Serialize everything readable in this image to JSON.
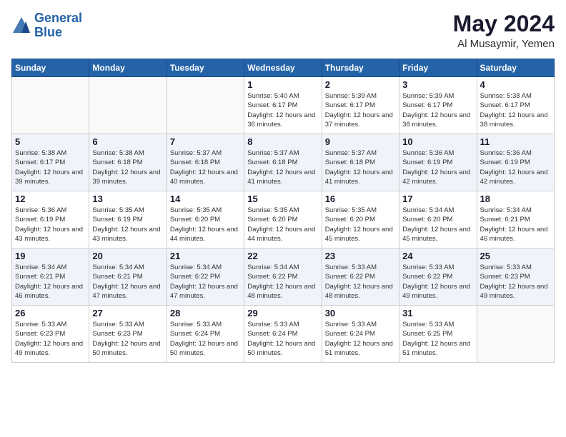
{
  "header": {
    "logo_line1": "General",
    "logo_line2": "Blue",
    "month_year": "May 2024",
    "location": "Al Musaymir, Yemen"
  },
  "weekdays": [
    "Sunday",
    "Monday",
    "Tuesday",
    "Wednesday",
    "Thursday",
    "Friday",
    "Saturday"
  ],
  "weeks": [
    [
      {
        "day": "",
        "sunrise": "",
        "sunset": "",
        "daylight": ""
      },
      {
        "day": "",
        "sunrise": "",
        "sunset": "",
        "daylight": ""
      },
      {
        "day": "",
        "sunrise": "",
        "sunset": "",
        "daylight": ""
      },
      {
        "day": "1",
        "sunrise": "Sunrise: 5:40 AM",
        "sunset": "Sunset: 6:17 PM",
        "daylight": "Daylight: 12 hours and 36 minutes."
      },
      {
        "day": "2",
        "sunrise": "Sunrise: 5:39 AM",
        "sunset": "Sunset: 6:17 PM",
        "daylight": "Daylight: 12 hours and 37 minutes."
      },
      {
        "day": "3",
        "sunrise": "Sunrise: 5:39 AM",
        "sunset": "Sunset: 6:17 PM",
        "daylight": "Daylight: 12 hours and 38 minutes."
      },
      {
        "day": "4",
        "sunrise": "Sunrise: 5:38 AM",
        "sunset": "Sunset: 6:17 PM",
        "daylight": "Daylight: 12 hours and 38 minutes."
      }
    ],
    [
      {
        "day": "5",
        "sunrise": "Sunrise: 5:38 AM",
        "sunset": "Sunset: 6:17 PM",
        "daylight": "Daylight: 12 hours and 39 minutes."
      },
      {
        "day": "6",
        "sunrise": "Sunrise: 5:38 AM",
        "sunset": "Sunset: 6:18 PM",
        "daylight": "Daylight: 12 hours and 39 minutes."
      },
      {
        "day": "7",
        "sunrise": "Sunrise: 5:37 AM",
        "sunset": "Sunset: 6:18 PM",
        "daylight": "Daylight: 12 hours and 40 minutes."
      },
      {
        "day": "8",
        "sunrise": "Sunrise: 5:37 AM",
        "sunset": "Sunset: 6:18 PM",
        "daylight": "Daylight: 12 hours and 41 minutes."
      },
      {
        "day": "9",
        "sunrise": "Sunrise: 5:37 AM",
        "sunset": "Sunset: 6:18 PM",
        "daylight": "Daylight: 12 hours and 41 minutes."
      },
      {
        "day": "10",
        "sunrise": "Sunrise: 5:36 AM",
        "sunset": "Sunset: 6:19 PM",
        "daylight": "Daylight: 12 hours and 42 minutes."
      },
      {
        "day": "11",
        "sunrise": "Sunrise: 5:36 AM",
        "sunset": "Sunset: 6:19 PM",
        "daylight": "Daylight: 12 hours and 42 minutes."
      }
    ],
    [
      {
        "day": "12",
        "sunrise": "Sunrise: 5:36 AM",
        "sunset": "Sunset: 6:19 PM",
        "daylight": "Daylight: 12 hours and 43 minutes."
      },
      {
        "day": "13",
        "sunrise": "Sunrise: 5:35 AM",
        "sunset": "Sunset: 6:19 PM",
        "daylight": "Daylight: 12 hours and 43 minutes."
      },
      {
        "day": "14",
        "sunrise": "Sunrise: 5:35 AM",
        "sunset": "Sunset: 6:20 PM",
        "daylight": "Daylight: 12 hours and 44 minutes."
      },
      {
        "day": "15",
        "sunrise": "Sunrise: 5:35 AM",
        "sunset": "Sunset: 6:20 PM",
        "daylight": "Daylight: 12 hours and 44 minutes."
      },
      {
        "day": "16",
        "sunrise": "Sunrise: 5:35 AM",
        "sunset": "Sunset: 6:20 PM",
        "daylight": "Daylight: 12 hours and 45 minutes."
      },
      {
        "day": "17",
        "sunrise": "Sunrise: 5:34 AM",
        "sunset": "Sunset: 6:20 PM",
        "daylight": "Daylight: 12 hours and 45 minutes."
      },
      {
        "day": "18",
        "sunrise": "Sunrise: 5:34 AM",
        "sunset": "Sunset: 6:21 PM",
        "daylight": "Daylight: 12 hours and 46 minutes."
      }
    ],
    [
      {
        "day": "19",
        "sunrise": "Sunrise: 5:34 AM",
        "sunset": "Sunset: 6:21 PM",
        "daylight": "Daylight: 12 hours and 46 minutes."
      },
      {
        "day": "20",
        "sunrise": "Sunrise: 5:34 AM",
        "sunset": "Sunset: 6:21 PM",
        "daylight": "Daylight: 12 hours and 47 minutes."
      },
      {
        "day": "21",
        "sunrise": "Sunrise: 5:34 AM",
        "sunset": "Sunset: 6:22 PM",
        "daylight": "Daylight: 12 hours and 47 minutes."
      },
      {
        "day": "22",
        "sunrise": "Sunrise: 5:34 AM",
        "sunset": "Sunset: 6:22 PM",
        "daylight": "Daylight: 12 hours and 48 minutes."
      },
      {
        "day": "23",
        "sunrise": "Sunrise: 5:33 AM",
        "sunset": "Sunset: 6:22 PM",
        "daylight": "Daylight: 12 hours and 48 minutes."
      },
      {
        "day": "24",
        "sunrise": "Sunrise: 5:33 AM",
        "sunset": "Sunset: 6:22 PM",
        "daylight": "Daylight: 12 hours and 49 minutes."
      },
      {
        "day": "25",
        "sunrise": "Sunrise: 5:33 AM",
        "sunset": "Sunset: 6:23 PM",
        "daylight": "Daylight: 12 hours and 49 minutes."
      }
    ],
    [
      {
        "day": "26",
        "sunrise": "Sunrise: 5:33 AM",
        "sunset": "Sunset: 6:23 PM",
        "daylight": "Daylight: 12 hours and 49 minutes."
      },
      {
        "day": "27",
        "sunrise": "Sunrise: 5:33 AM",
        "sunset": "Sunset: 6:23 PM",
        "daylight": "Daylight: 12 hours and 50 minutes."
      },
      {
        "day": "28",
        "sunrise": "Sunrise: 5:33 AM",
        "sunset": "Sunset: 6:24 PM",
        "daylight": "Daylight: 12 hours and 50 minutes."
      },
      {
        "day": "29",
        "sunrise": "Sunrise: 5:33 AM",
        "sunset": "Sunset: 6:24 PM",
        "daylight": "Daylight: 12 hours and 50 minutes."
      },
      {
        "day": "30",
        "sunrise": "Sunrise: 5:33 AM",
        "sunset": "Sunset: 6:24 PM",
        "daylight": "Daylight: 12 hours and 51 minutes."
      },
      {
        "day": "31",
        "sunrise": "Sunrise: 5:33 AM",
        "sunset": "Sunset: 6:25 PM",
        "daylight": "Daylight: 12 hours and 51 minutes."
      },
      {
        "day": "",
        "sunrise": "",
        "sunset": "",
        "daylight": ""
      }
    ]
  ]
}
